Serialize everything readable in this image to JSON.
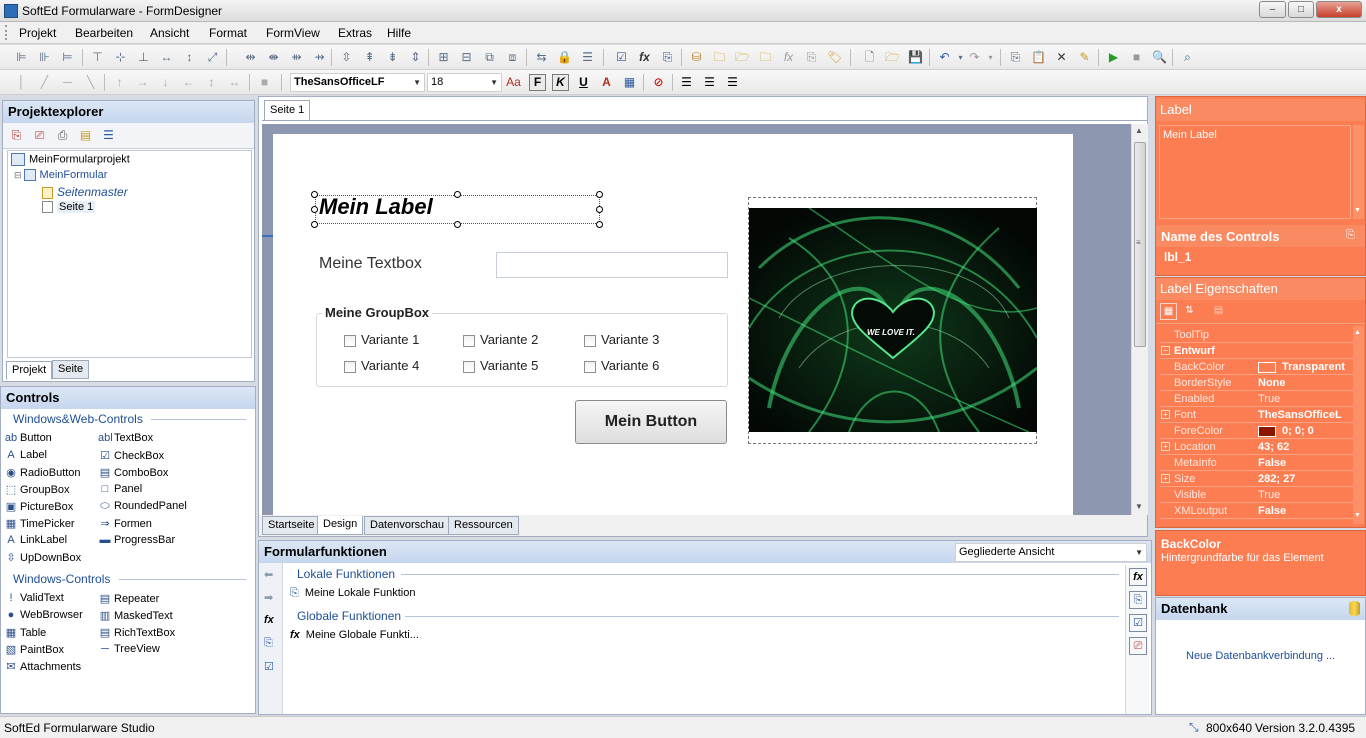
{
  "window": {
    "title": "SoftEd Formularware - FormDesigner",
    "min": "–",
    "max": "□",
    "close": "x"
  },
  "menu": [
    "Projekt",
    "Bearbeiten",
    "Ansicht",
    "Format",
    "FormView",
    "Extras",
    "Hilfe"
  ],
  "format_toolbar": {
    "font_name": "TheSansOfficeLF",
    "font_size": "18",
    "bold": "F",
    "italic": "K",
    "underline": "U",
    "grow": "Aa"
  },
  "projektexplorer": {
    "title": "Projektexplorer",
    "tree": [
      "MeinFormularprojekt",
      "MeinFormular",
      "Seitenmaster",
      "Seite 1"
    ],
    "tabs": [
      "Projekt",
      "Seite"
    ]
  },
  "controls": {
    "title": "Controls",
    "section_web": "Windows&Web-Controls",
    "web_left": [
      {
        "label": "Button",
        "icon": "ab"
      },
      {
        "label": "Label",
        "icon": "A"
      },
      {
        "label": "RadioButton",
        "icon": "◉"
      },
      {
        "label": "GroupBox",
        "icon": "⬚"
      },
      {
        "label": "PictureBox",
        "icon": "▣"
      },
      {
        "label": "TimePicker",
        "icon": "▦"
      },
      {
        "label": "LinkLabel",
        "icon": "A"
      },
      {
        "label": "UpDownBox",
        "icon": "⇳"
      }
    ],
    "web_right": [
      {
        "label": "TextBox",
        "icon": "abl"
      },
      {
        "label": "CheckBox",
        "icon": "☑"
      },
      {
        "label": "ComboBox",
        "icon": "▤"
      },
      {
        "label": "Panel",
        "icon": "□"
      },
      {
        "label": "RoundedPanel",
        "icon": "⬭"
      },
      {
        "label": "Formen",
        "icon": "⇒"
      },
      {
        "label": "ProgressBar",
        "icon": "▬"
      }
    ],
    "section_win": "Windows-Controls",
    "win_left": [
      {
        "label": "ValidText",
        "icon": "!"
      },
      {
        "label": "WebBrowser",
        "icon": "●"
      },
      {
        "label": "Table",
        "icon": "▦"
      },
      {
        "label": "PaintBox",
        "icon": "▧"
      },
      {
        "label": "Attachments",
        "icon": "✉"
      }
    ],
    "win_right": [
      {
        "label": "Repeater",
        "icon": "▤"
      },
      {
        "label": "MaskedText",
        "icon": "▥"
      },
      {
        "label": "RichTextBox",
        "icon": "▤"
      },
      {
        "label": "TreeView",
        "icon": "─"
      }
    ]
  },
  "designer": {
    "page_tab": "Seite 1",
    "label_text": "Mein Label",
    "textbox_label": "Meine Textbox",
    "groupbox_title": "Meine GroupBox",
    "checkboxes": [
      "Variante 1",
      "Variante 2",
      "Variante 3",
      "Variante 4",
      "Variante 5",
      "Variante 6"
    ],
    "button_text": "Mein Button",
    "image_caption": "WE LOVE IT.",
    "bottom_tabs": [
      "Startseite",
      "Design",
      "Datenvorschau",
      "Ressourcen"
    ]
  },
  "formularfunktionen": {
    "title": "Formularfunktionen",
    "view_select": "Gegliederte Ansicht",
    "lokal_header": "Lokale Funktionen",
    "lokal_item": "Meine Lokale Funktion",
    "global_header": "Globale Funktionen",
    "global_item": "Meine Globale Funkti..."
  },
  "label_panel": {
    "title": "Label",
    "text": "Mein Label",
    "name_header": "Name des Controls",
    "name_value": "lbl_1"
  },
  "properties": {
    "title": "Label Eigenschaften",
    "rows": [
      {
        "name": "ToolTip",
        "value": "",
        "plus": false,
        "bold": false
      },
      {
        "name": "Entwurf",
        "value": "",
        "plus": true,
        "bold": true,
        "category": true
      },
      {
        "name": "BackColor",
        "value": "Transparent",
        "plus": false,
        "bold": true,
        "swatch": "#fd7d52"
      },
      {
        "name": "BorderStyle",
        "value": "None",
        "plus": false,
        "bold": true
      },
      {
        "name": "Enabled",
        "value": "True",
        "plus": false,
        "bold": false
      },
      {
        "name": "Font",
        "value": "TheSansOfficeL",
        "plus": true,
        "bold": true
      },
      {
        "name": "ForeColor",
        "value": "0; 0; 0",
        "plus": false,
        "bold": true,
        "swatch": "#8a1600"
      },
      {
        "name": "Location",
        "value": "43; 62",
        "plus": true,
        "bold": true
      },
      {
        "name": "MetaInfo",
        "value": "False",
        "plus": false,
        "bold": true
      },
      {
        "name": "Size",
        "value": "282; 27",
        "plus": true,
        "bold": true
      },
      {
        "name": "Visible",
        "value": "True",
        "plus": false,
        "bold": false
      },
      {
        "name": "XMLoutput",
        "value": "False",
        "plus": false,
        "bold": true
      }
    ],
    "desc_title": "BackColor",
    "desc_text": "Hintergrundfarbe für das Element"
  },
  "datenbank": {
    "title": "Datenbank",
    "link": "Neue Datenbankverbindung ..."
  },
  "status": {
    "left": "SoftEd Formularware Studio",
    "resolution": "800x640",
    "version": "Version 3.2.0.4395"
  }
}
